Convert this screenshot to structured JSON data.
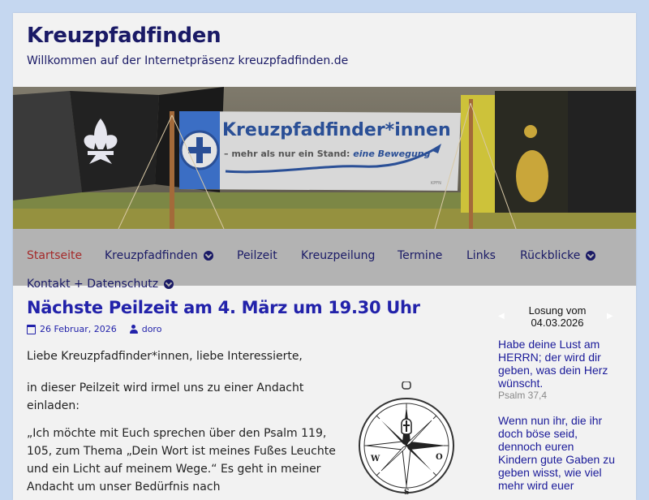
{
  "header": {
    "site_title": "Kreuzpfadfinden",
    "site_description": "Willkommen auf der Internetpräsenz kreuzpfadfinden.de"
  },
  "banner": {
    "sign_title": "Kreuzpfadfinder*innen",
    "sign_subtitle_pre": "– mehr als nur ein Stand: ",
    "sign_subtitle_em": "eine Bewegung",
    "sign_small": "KPFN"
  },
  "nav": {
    "items": [
      {
        "label": "Startseite",
        "active": true,
        "dropdown": false
      },
      {
        "label": "Kreuzpfadfinden",
        "active": false,
        "dropdown": true
      },
      {
        "label": "Peilzeit",
        "active": false,
        "dropdown": false
      },
      {
        "label": "Kreuzpeilung",
        "active": false,
        "dropdown": false
      },
      {
        "label": "Termine",
        "active": false,
        "dropdown": false
      },
      {
        "label": "Links",
        "active": false,
        "dropdown": false
      },
      {
        "label": "Rückblicke",
        "active": false,
        "dropdown": true
      },
      {
        "label": "Kontakt + Datenschutz",
        "active": false,
        "dropdown": true
      }
    ]
  },
  "post": {
    "title": "Nächste Peilzeit am 4. März um 19.30 Uhr",
    "date": "26 Februar, 2026",
    "author": "doro",
    "paragraphs": [
      "Liebe Kreuzpfadfinder*innen, liebe Interessierte,",
      "in dieser Peilzeit wird irmel uns zu einer Andacht einladen:",
      "„Ich möchte mit Euch sprechen über den Psalm 119, 105, zum Thema „Dein Wort ist meines Fußes Leuchte und ein Licht auf meinem Wege.“ Es geht in meiner Andacht um unser Bedürfnis nach"
    ],
    "compass": {
      "w": "W",
      "o": "O",
      "s": "S"
    }
  },
  "sidebar": {
    "losung_title": "Losung vom",
    "losung_date": "04.03.2026",
    "prev_arrow": "◀",
    "next_arrow": "▶",
    "verse": "Habe deine Lust am HERRN; der wird dir geben, was dein Herz wünscht.",
    "reference": "Psalm 37,4",
    "teaching": "Wenn nun ihr, die ihr doch böse seid, dennoch euren Kindern gute Gaben zu geben wisst, wie viel mehr wird euer"
  },
  "colors": {
    "page_bg": "#c5d7f0",
    "content_bg": "#f2f2f2",
    "nav_bg": "#b3b3b3",
    "title_color": "#1a1a66",
    "link_color": "#2222aa",
    "active_nav": "#a52a2a"
  }
}
